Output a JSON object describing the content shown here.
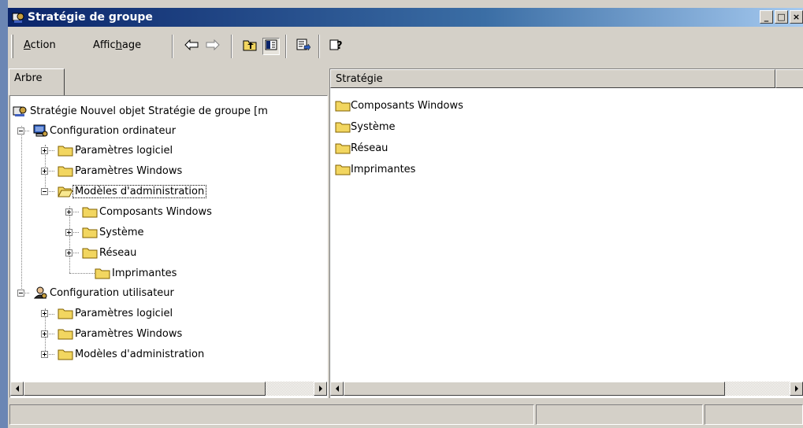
{
  "window": {
    "title": "Stratégie de groupe",
    "caption_buttons": {
      "minimize": "_",
      "maximize": "□",
      "close": "×"
    }
  },
  "menu": {
    "action": {
      "prefix": "",
      "mnemonic": "A",
      "suffix": "ction"
    },
    "affichage": {
      "prefix": "Affic",
      "mnemonic": "h",
      "suffix": "age"
    }
  },
  "toolbar_icons": [
    "back-arrow-icon",
    "forward-arrow-icon",
    "up-one-level-icon",
    "show-hide-tree-icon",
    "export-list-icon",
    "help-icon"
  ],
  "tabs": {
    "tree": "Arbre"
  },
  "tree": {
    "root": "Stratégie Nouvel objet Stratégie de groupe [m",
    "computer_config": "Configuration ordinateur",
    "c_software": "Paramètres logiciel",
    "c_windows": "Paramètres Windows",
    "c_admin": "Modèles d'administration",
    "c_admin_children": [
      "Composants Windows",
      "Système",
      "Réseau",
      "Imprimantes"
    ],
    "user_config": "Configuration utilisateur",
    "u_software": "Paramètres logiciel",
    "u_windows": "Paramètres Windows",
    "u_admin": "Modèles d'administration"
  },
  "details": {
    "column_header": "Stratégie",
    "items": [
      "Composants Windows",
      "Système",
      "Réseau",
      "Imprimantes"
    ]
  },
  "colors": {
    "titlebar_start": "#0a246a",
    "titlebar_end": "#a6caf0",
    "face": "#d4d0c8",
    "folder": "#f2d660"
  }
}
